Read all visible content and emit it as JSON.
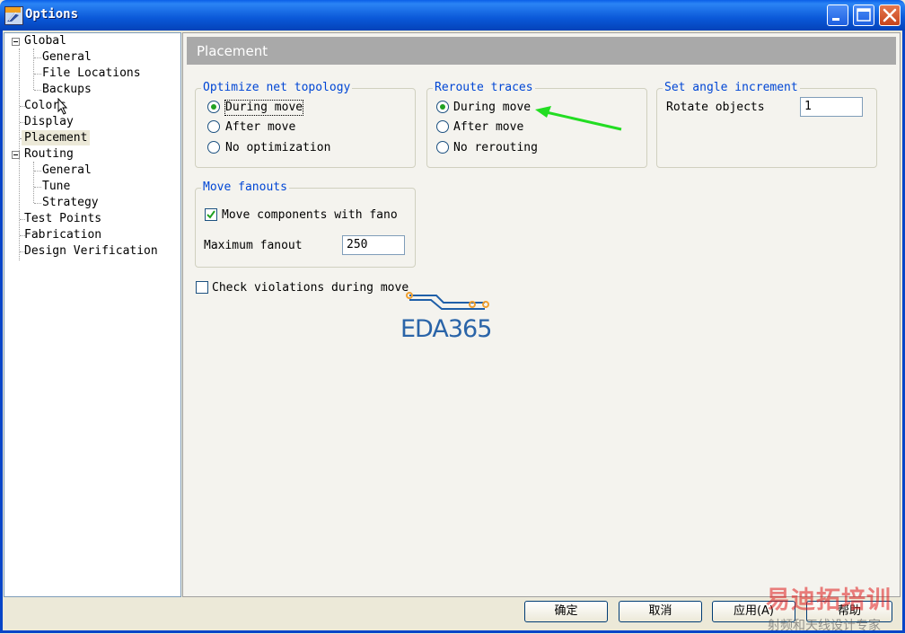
{
  "window": {
    "title": "Options"
  },
  "tree": {
    "items": [
      {
        "label": "Global"
      },
      {
        "label": "General"
      },
      {
        "label": "File Locations"
      },
      {
        "label": "Backups"
      },
      {
        "label": "Colors"
      },
      {
        "label": "Display"
      },
      {
        "label": "Placement"
      },
      {
        "label": "Routing"
      },
      {
        "label": "General"
      },
      {
        "label": "Tune"
      },
      {
        "label": "Strategy"
      },
      {
        "label": "Test Points"
      },
      {
        "label": "Fabrication"
      },
      {
        "label": "Design Verification"
      }
    ],
    "selected": "Placement"
  },
  "panel": {
    "title": "Placement"
  },
  "optimize": {
    "legend": "Optimize net topology",
    "options": [
      "During move",
      "After move",
      "No optimization"
    ],
    "selected": "During move"
  },
  "reroute": {
    "legend": "Reroute traces",
    "options": [
      "During move",
      "After move",
      "No rerouting"
    ],
    "selected": "During move"
  },
  "angle": {
    "legend": "Set angle increment",
    "label": "Rotate objects",
    "value": "1"
  },
  "fanouts": {
    "legend": "Move fanouts",
    "checkbox_label": "Move components with fano",
    "checked": true,
    "max_label": "Maximum fanout",
    "max_value": "250"
  },
  "check_violations": {
    "label": "Check violations during move",
    "checked": false
  },
  "buttons": {
    "ok": "确定",
    "cancel": "取消",
    "apply": "应用(A)",
    "help": "帮助"
  },
  "watermark": {
    "logo": "EDA365",
    "brand": "易迪拓培训",
    "tagline": "射频和天线设计专家"
  },
  "colors": {
    "title_bar": "#0a58d8",
    "legend": "#0046d5",
    "arrow": "#22dd22",
    "watermark_red": "#e01c1c"
  }
}
